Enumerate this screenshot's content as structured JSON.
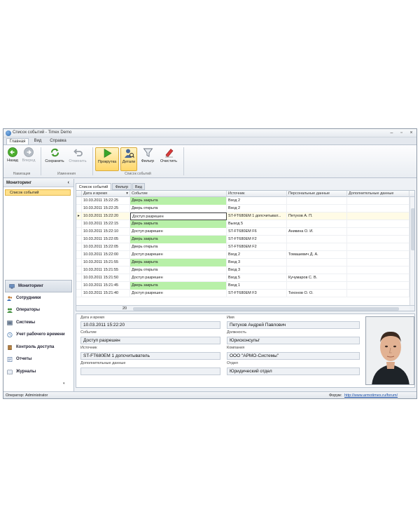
{
  "window": {
    "title": "Список событий - Timex Demo"
  },
  "ribbon": {
    "tabs": [
      "Главная",
      "Вид",
      "Справка"
    ],
    "buttons": {
      "back": "Назад",
      "forward": "Вперед",
      "save": "Сохранить",
      "cancel": "Отменить",
      "scroll": "Прокрутка",
      "details": "Детали",
      "filter": "Фильтр",
      "clear": "Очистить"
    },
    "groups": {
      "nav": "Навигация",
      "changes": "Изменения",
      "events": "Список событий"
    }
  },
  "sidebar": {
    "header": "Мониторинг",
    "collapse": "‹",
    "selected_item": "Список событий",
    "nav": [
      {
        "label": "Мониторинг",
        "icon": "monitor-icon"
      },
      {
        "label": "Сотрудники",
        "icon": "employees-icon"
      },
      {
        "label": "Операторы",
        "icon": "operators-icon"
      },
      {
        "label": "Системы",
        "icon": "systems-icon"
      },
      {
        "label": "Учет рабочего времени",
        "icon": "time-tracking-icon"
      },
      {
        "label": "Контроль доступа",
        "icon": "access-control-icon"
      },
      {
        "label": "Отчеты",
        "icon": "reports-icon"
      },
      {
        "label": "Журналы",
        "icon": "journals-icon"
      }
    ],
    "scroll_arrow": "▾"
  },
  "content_tabs": [
    "Список событий",
    "Фильтр",
    "Вид"
  ],
  "grid": {
    "columns": [
      "Дата и время",
      "Событие",
      "Источник",
      "Персональные данные",
      "Дополнительные данные"
    ],
    "rows": [
      {
        "dt": "10.03.2011 15:22:25",
        "event": "Дверь закрыта",
        "src": "Вход 2",
        "person": "",
        "extra": "",
        "green": true
      },
      {
        "dt": "10.03.2011 15:22:25",
        "event": "Дверь открыта",
        "src": "Вход 2",
        "person": "",
        "extra": "",
        "green": false
      },
      {
        "dt": "10.03.2011 15:22:20",
        "event": "Доступ разрешен",
        "src": "ST-FT680EM 1 допсчитыват...",
        "person": "Петухов А. П.",
        "extra": "",
        "green": false,
        "current": true
      },
      {
        "dt": "10.03.2011 15:22:15",
        "event": "Дверь закрыта",
        "src": "Выход 5",
        "person": "",
        "extra": "",
        "green": true
      },
      {
        "dt": "10.03.2011 15:22:10",
        "event": "Доступ разрешен",
        "src": "ST-FT680EM F6",
        "person": "Аникина О. И.",
        "extra": "",
        "green": false
      },
      {
        "dt": "10.03.2011 15:22:05",
        "event": "Дверь закрыта",
        "src": "ST-FT680EM F2",
        "person": "",
        "extra": "",
        "green": true
      },
      {
        "dt": "10.03.2011 15:22:05",
        "event": "Дверь открыта",
        "src": "ST-FT680EM F2",
        "person": "",
        "extra": "",
        "green": false
      },
      {
        "dt": "10.03.2011 15:22:00",
        "event": "Доступ разрешен",
        "src": "Вход 2",
        "person": "Томашевич Д. А.",
        "extra": "",
        "green": false
      },
      {
        "dt": "10.03.2011 15:21:55",
        "event": "Дверь закрыта",
        "src": "Вход 3",
        "person": "",
        "extra": "",
        "green": true
      },
      {
        "dt": "10.03.2011 15:21:55",
        "event": "Дверь открыта",
        "src": "Вход 3",
        "person": "",
        "extra": "",
        "green": false
      },
      {
        "dt": "10.03.2011 15:21:50",
        "event": "Доступ разрешен",
        "src": "Вход 5",
        "person": "Кучумаров С. В.",
        "extra": "",
        "green": false
      },
      {
        "dt": "10.03.2011 15:21:45",
        "event": "Дверь закрыта",
        "src": "Вход 1",
        "person": "",
        "extra": "",
        "green": true
      },
      {
        "dt": "10.03.2011 15:21:40",
        "event": "Доступ разрешен",
        "src": "ST-FT680EM F3",
        "person": "Тихонов О. О.",
        "extra": "",
        "green": false
      }
    ],
    "footer_count": "20"
  },
  "details": {
    "labels": {
      "datetime": "Дата и время",
      "event": "Событие",
      "source": "Источник",
      "extra": "Дополнительные данные",
      "name": "Имя",
      "position": "Должность",
      "company": "Компания",
      "department": "Отдел"
    },
    "values": {
      "datetime": "10.03.2011 15:22:20",
      "event": "Доступ разрешен",
      "source": "ST-FT680EM 1 допсчитыватель",
      "extra": "",
      "name": "Петухов Андрей Павлович",
      "position": "Юрисконсульт",
      "company": "ООО \"АРМО-Системы\"",
      "department": "Юридический отдел"
    }
  },
  "statusbar": {
    "operator": "Оператор: Administrator",
    "forum_label": "Форум:",
    "forum_url": "http://www.armotimex.ru/forum/"
  }
}
